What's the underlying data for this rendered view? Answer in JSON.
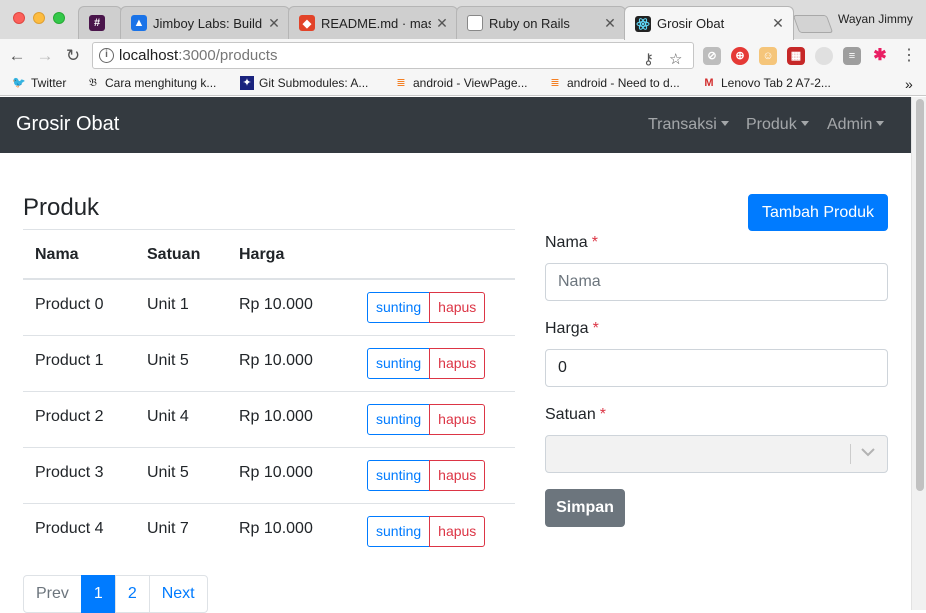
{
  "browser": {
    "tabs": [
      {
        "title": "#",
        "icon": "slack-icon",
        "color": "#4a154b"
      },
      {
        "title": "Jimboy Labs: Build S",
        "icon": "jimboy-icon",
        "color": "#1a73e8"
      },
      {
        "title": "README.md · maste",
        "icon": "gitlab-icon",
        "color": "#e24329"
      },
      {
        "title": "Ruby on Rails",
        "icon": "document-icon",
        "color": "#777777"
      },
      {
        "title": "Grosir Obat",
        "icon": "react-icon",
        "color": "#222222"
      }
    ],
    "profile_name": "Wayan Jimmy",
    "url_host": "localhost",
    "url_path": ":3000/products",
    "bookmarks": [
      {
        "label": "Twitter",
        "icon": "twitter-icon"
      },
      {
        "label": "Cara menghitung k...",
        "icon": "bookmark-site-icon"
      },
      {
        "label": "Git Submodules: A...",
        "icon": "bookmark-site-icon"
      },
      {
        "label": "android - ViewPage...",
        "icon": "stackoverflow-icon"
      },
      {
        "label": "android - Need to d...",
        "icon": "stackoverflow-icon"
      },
      {
        "label": "Lenovo Tab 2 A7-2...",
        "icon": "bookmark-site-icon"
      }
    ],
    "more_bookmarks": "»"
  },
  "app": {
    "brand": "Grosir Obat",
    "nav": [
      {
        "label": "Transaksi"
      },
      {
        "label": "Produk"
      },
      {
        "label": "Admin"
      }
    ],
    "page_title": "Produk",
    "add_button": "Tambah Produk",
    "table": {
      "headers": [
        "Nama",
        "Satuan",
        "Harga"
      ],
      "rows": [
        {
          "name": "Product 0",
          "unit": "Unit 1",
          "price": "Rp 10.000"
        },
        {
          "name": "Product 1",
          "unit": "Unit 5",
          "price": "Rp 10.000"
        },
        {
          "name": "Product 2",
          "unit": "Unit 4",
          "price": "Rp 10.000"
        },
        {
          "name": "Product 3",
          "unit": "Unit 5",
          "price": "Rp 10.000"
        },
        {
          "name": "Product 4",
          "unit": "Unit 7",
          "price": "Rp 10.000"
        }
      ],
      "edit_label": "sunting",
      "delete_label": "hapus"
    },
    "pagination": {
      "prev": "Prev",
      "pages": [
        "1",
        "2"
      ],
      "active": "1",
      "next": "Next"
    },
    "form": {
      "name_label": "Nama",
      "name_placeholder": "Nama",
      "price_label": "Harga",
      "price_value": "0",
      "unit_label": "Satuan",
      "required_mark": "*",
      "submit": "Simpan"
    }
  },
  "colors": {
    "navbar": "#343a40",
    "primary": "#007bff",
    "danger": "#dc3545",
    "secondary": "#6c757d"
  }
}
